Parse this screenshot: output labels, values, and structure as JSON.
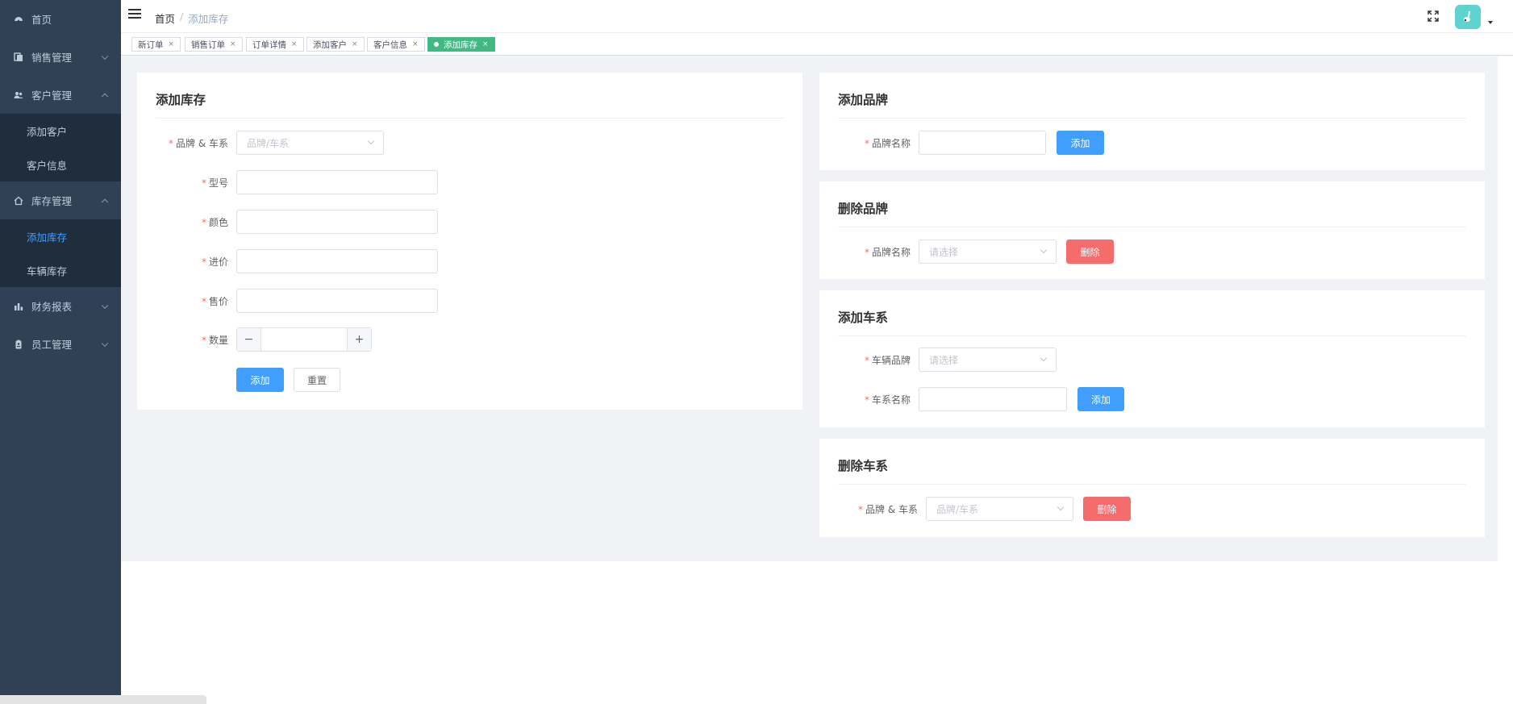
{
  "sidebar": {
    "items": [
      {
        "label": "首页",
        "icon": "dashboard-icon"
      },
      {
        "label": "销售管理",
        "icon": "document-icon"
      },
      {
        "label": "客户管理",
        "icon": "people-icon",
        "children": [
          "添加客户",
          "客户信息"
        ]
      },
      {
        "label": "库存管理",
        "icon": "home-icon",
        "children": [
          "添加库存",
          "车辆库存"
        ]
      },
      {
        "label": "财务报表",
        "icon": "bar-chart-icon"
      },
      {
        "label": "员工管理",
        "icon": "badge-icon"
      }
    ]
  },
  "navbar": {
    "breadcrumb": {
      "home": "首页",
      "separator": "/",
      "current": "添加库存"
    }
  },
  "tags": [
    {
      "label": "新订单"
    },
    {
      "label": "销售订单"
    },
    {
      "label": "订单详情"
    },
    {
      "label": "添加客户"
    },
    {
      "label": "客户信息"
    },
    {
      "label": "添加库存"
    }
  ],
  "add_stock": {
    "title": "添加库存",
    "brand_series": {
      "label": "品牌 & 车系",
      "placeholder": "品牌/车系"
    },
    "model_label": "型号",
    "color_label": "颜色",
    "purchase_price_label": "进价",
    "sale_price_label": "售价",
    "quantity_label": "数量",
    "minus": "−",
    "plus": "+",
    "add_button": "添加",
    "reset_button": "重置"
  },
  "add_brand": {
    "title": "添加品牌",
    "brand_name_label": "品牌名称",
    "add_button": "添加"
  },
  "delete_brand": {
    "title": "删除品牌",
    "brand_name_label": "品牌名称",
    "placeholder": "请选择",
    "delete_button": "删除"
  },
  "add_series": {
    "title": "添加车系",
    "vehicle_brand_label": "车辆品牌",
    "placeholder": "请选择",
    "series_name_label": "车系名称",
    "add_button": "添加"
  },
  "delete_series": {
    "title": "删除车系",
    "brand_series_label": "品牌 & 车系",
    "placeholder": "品牌/车系",
    "delete_button": "删除"
  },
  "colors": {
    "sidebar_bg": "#304156",
    "submenu_bg": "#1f2d3d",
    "active_link": "#409eff",
    "active_tag": "#42b983",
    "danger": "#f56c6c",
    "avatar_bg": "#5fd3cf"
  }
}
